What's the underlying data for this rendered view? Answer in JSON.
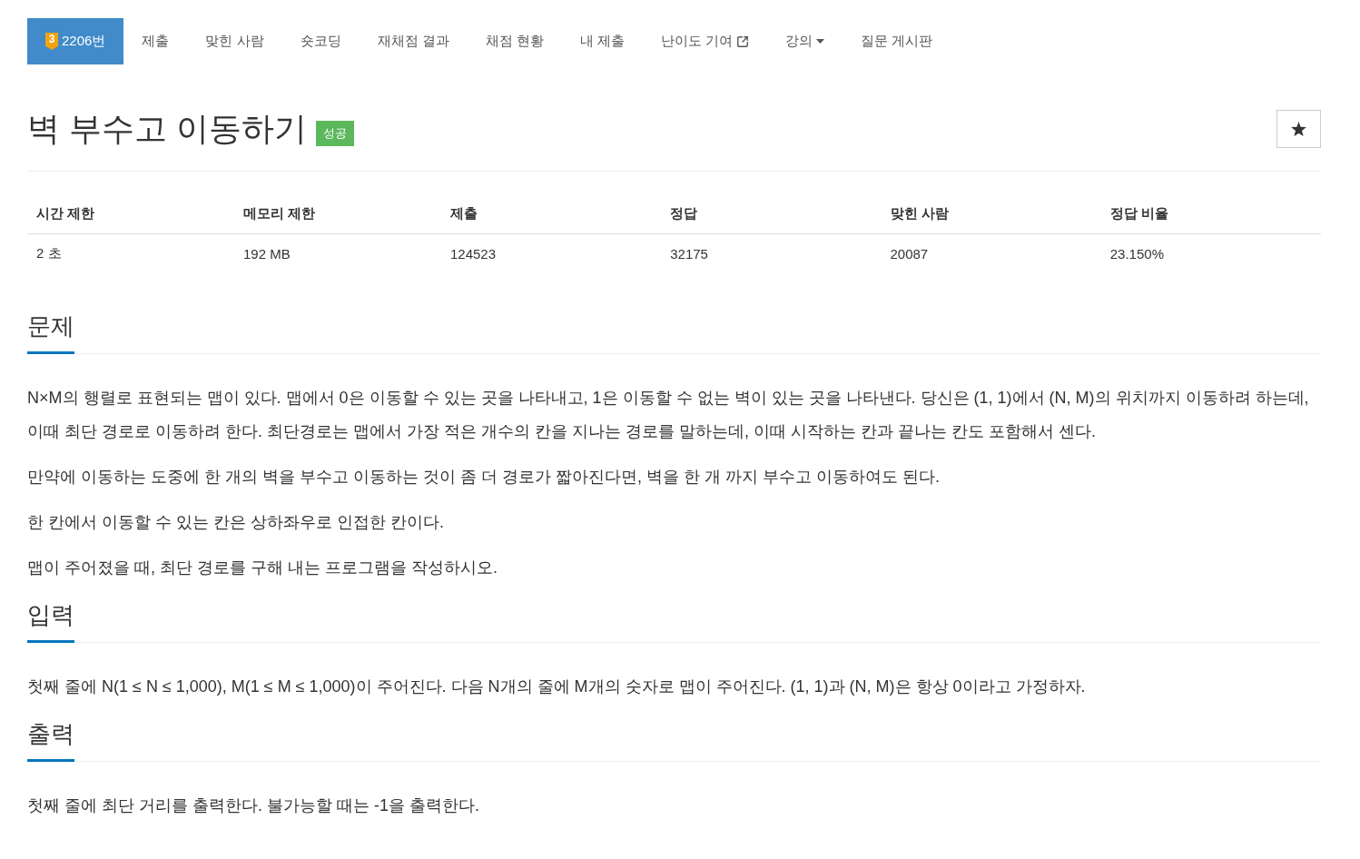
{
  "nav": {
    "tabs": [
      {
        "label": "2206번",
        "kind": "problem",
        "tier": "3",
        "selected": true
      },
      {
        "label": "제출",
        "kind": "plain",
        "selected": false
      },
      {
        "label": "맞힌 사람",
        "kind": "plain",
        "selected": false
      },
      {
        "label": "숏코딩",
        "kind": "plain",
        "selected": false
      },
      {
        "label": "재채점 결과",
        "kind": "plain",
        "selected": false
      },
      {
        "label": "채점 현황",
        "kind": "plain",
        "selected": false
      },
      {
        "label": "내 제출",
        "kind": "plain",
        "selected": false
      },
      {
        "label": "난이도 기여",
        "kind": "external",
        "selected": false
      },
      {
        "label": "강의",
        "kind": "dropdown",
        "selected": false
      },
      {
        "label": "질문 게시판",
        "kind": "plain",
        "selected": false
      }
    ]
  },
  "problem": {
    "title": "벽 부수고 이동하기",
    "result": {
      "label": "성공",
      "kind": "success"
    }
  },
  "info_table": {
    "columns": [
      "시간 제한",
      "메모리 제한",
      "제출",
      "정답",
      "맞힌 사람",
      "정답 비율"
    ],
    "rows": [
      [
        "2 초",
        "192 MB",
        "124523",
        "32175",
        "20087",
        "23.150%"
      ]
    ]
  },
  "sections": [
    {
      "heading": "문제",
      "paragraphs": [
        "N×M의 행렬로 표현되는 맵이 있다. 맵에서 0은 이동할 수 있는 곳을 나타내고, 1은 이동할 수 없는 벽이 있는 곳을 나타낸다. 당신은 (1, 1)에서 (N, M)의 위치까지 이동하려 하는데, 이때 최단 경로로 이동하려 한다. 최단경로는 맵에서 가장 적은 개수의 칸을 지나는 경로를 말하는데, 이때 시작하는 칸과 끝나는 칸도 포함해서 센다.",
        "만약에 이동하는 도중에 한 개의 벽을 부수고 이동하는 것이 좀 더 경로가 짧아진다면, 벽을 한 개 까지 부수고 이동하여도 된다.",
        "한 칸에서 이동할 수 있는 칸은 상하좌우로 인접한 칸이다.",
        "맵이 주어졌을 때, 최단 경로를 구해 내는 프로그램을 작성하시오."
      ]
    },
    {
      "heading": "입력",
      "paragraphs": [
        "첫째 줄에 N(1 ≤ N ≤ 1,000), M(1 ≤ M ≤ 1,000)이 주어진다. 다음 N개의 줄에 M개의 숫자로 맵이 주어진다. (1, 1)과 (N, M)은 항상 0이라고 가정하자."
      ]
    },
    {
      "heading": "출력",
      "paragraphs": [
        "첫째 줄에 최단 거리를 출력한다. 불가능할 때는 -1을 출력한다."
      ]
    }
  ]
}
